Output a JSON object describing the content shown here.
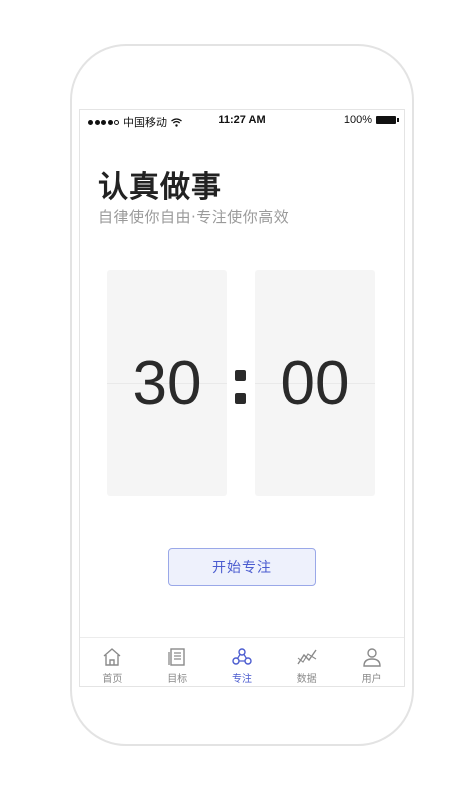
{
  "status_bar": {
    "carrier": "中国移动",
    "time": "11:27 AM",
    "battery": "100%"
  },
  "header": {
    "title": "认真做事",
    "subtitle": "自律使你自由·专注使你高效"
  },
  "timer": {
    "minutes": "30",
    "seconds": "00"
  },
  "start_button": "开始专注",
  "tabs": [
    {
      "label": "首页",
      "icon": "home-icon",
      "active": false
    },
    {
      "label": "目标",
      "icon": "target-icon",
      "active": false
    },
    {
      "label": "专注",
      "icon": "focus-icon",
      "active": true
    },
    {
      "label": "数据",
      "icon": "data-icon",
      "active": false
    },
    {
      "label": "用户",
      "icon": "user-icon",
      "active": false
    }
  ],
  "colors": {
    "accent": "#4a5bcf",
    "inactive": "#8a8a8a"
  }
}
